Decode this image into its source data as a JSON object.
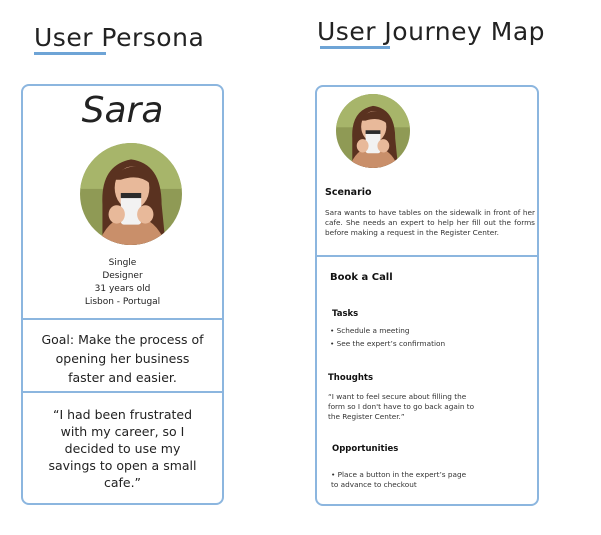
{
  "persona": {
    "heading": "User Persona",
    "name": "Sara",
    "details": [
      "Single",
      "Designer",
      "31 years old",
      "Lisbon - Portugal"
    ],
    "goal": "Goal: Make the process of opening her business faster and easier.",
    "quote": "“I had been frustrated with my career, so I decided to use my savings to open a small cafe.”"
  },
  "journey": {
    "heading": "User Journey Map",
    "scenario_title": "Scenario",
    "scenario_text": "Sara wants to have tables on the sidewalk in front of her cafe. She needs an expert to help her fill out the forms before making a request in the Register Center.",
    "stage_title": "Book a Call",
    "tasks_title": "Tasks",
    "tasks": [
      "• Schedule a meeting",
      "• See the expert’s confirmation"
    ],
    "thoughts_title": "Thoughts",
    "thoughts_text": "“I want to feel secure about filling the form so I don't have to go back again to the Register Center.”",
    "opportunities_title": "Opportunities",
    "opportunities_text": "• Place a button in the expert’s page to advance to checkout"
  },
  "colors": {
    "accent": "#6ea4d6",
    "card_border": "#8cb6df"
  }
}
